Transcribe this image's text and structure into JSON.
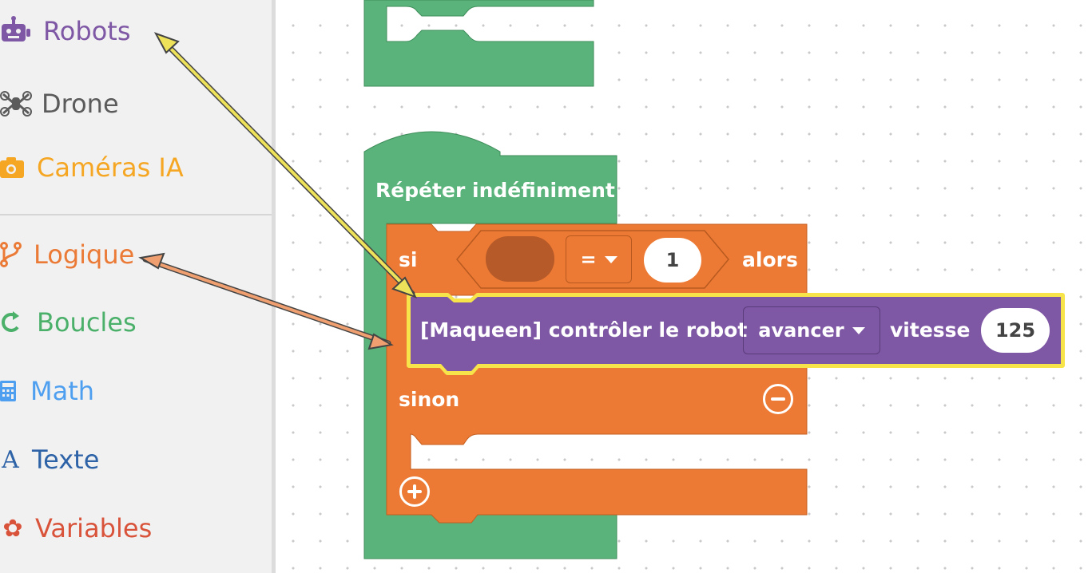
{
  "sidebar": {
    "categories": [
      {
        "label": "Robots",
        "icon": "robot-icon",
        "color": "#7e57a5"
      },
      {
        "label": "Drone",
        "icon": "drone-icon",
        "color": "#5b5b5b"
      },
      {
        "label": "Caméras IA",
        "icon": "camera-icon",
        "color": "#f5a623"
      },
      {
        "label": "Logique",
        "icon": "branch-icon",
        "color": "#ea7a36"
      },
      {
        "label": "Boucles",
        "icon": "loop-icon",
        "color": "#4bb06a"
      },
      {
        "label": "Math",
        "icon": "calculator-icon",
        "color": "#4e9ff0"
      },
      {
        "label": "Texte",
        "icon": "text-icon",
        "color": "#2e63a8"
      },
      {
        "label": "Variables",
        "icon": "gear-icon",
        "color": "#d9533b"
      }
    ]
  },
  "blocks": {
    "repeat": {
      "label": "Répéter indéfiniment",
      "color": "#59b37a"
    },
    "if_block": {
      "if_label": "si",
      "operator": "=",
      "value": "1",
      "then_label": "alors",
      "else_label": "sinon",
      "color": "#ec7a34"
    },
    "robot_block": {
      "label": "[Maqueen] contrôler le robot",
      "direction": "avancer",
      "speed_label": "vitesse",
      "speed_value": "125",
      "color": "#7e57a5",
      "highlight": "#f7e44a"
    }
  },
  "annotations": {
    "arrow_robots_color": "#ede25a",
    "arrow_logique_color": "#f0a070"
  }
}
